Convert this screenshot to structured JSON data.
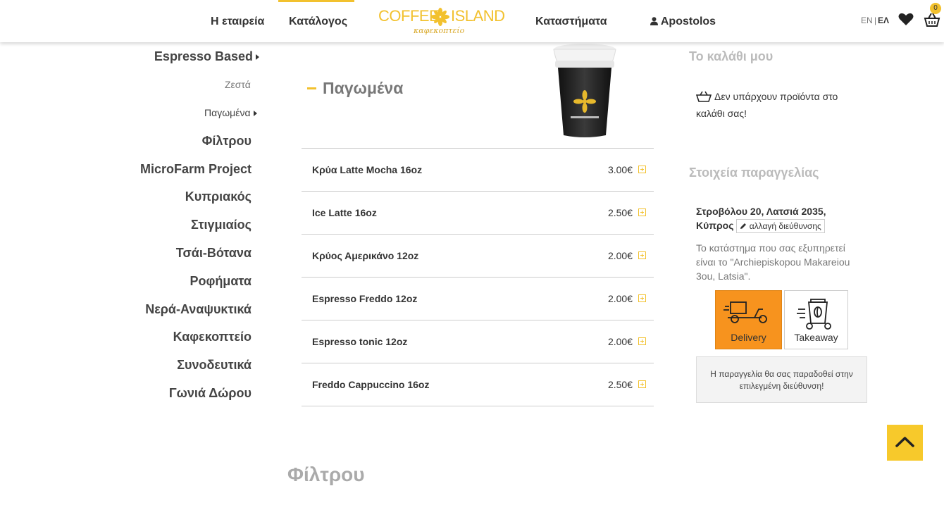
{
  "header": {
    "nav": {
      "company": "Η εταιρεία",
      "catalog": "Κατάλογος",
      "stores": "Καταστήματα",
      "user": "Apostolos"
    },
    "logo": {
      "brand_left": "COFFEE",
      "brand_right": "ISLAND",
      "tagline": "καφεκοπτείο"
    },
    "lang": {
      "en": "EN",
      "separator": "|",
      "el": "ΕΛ"
    },
    "cart_count": "0",
    "accent_color": "#f2c12e"
  },
  "sidebar": {
    "espresso_based": "Espresso Based",
    "sub_hot": "Ζεστά",
    "sub_iced": "Παγωμένα",
    "items": [
      "Φίλτρου",
      "MicroFarm Project",
      "Κυπριακός",
      "Στιγμιαίος",
      "Τσάι-Βότανα",
      "Ροφήματα",
      "Νερά-Αναψυκτικά",
      "Καφεκοπτείο",
      "Συνοδευτικά",
      "Γωνιά Δώρου"
    ]
  },
  "main": {
    "section_title": "Παγωμένα",
    "products": [
      {
        "name": "Κρύα Latte Mocha 16oz",
        "price": "3.00€"
      },
      {
        "name": "Ice Latte 16oz",
        "price": "2.50€"
      },
      {
        "name": "Κρύος Αμερικάνο 12oz",
        "price": "2.00€"
      },
      {
        "name": "Espresso Freddo 12oz",
        "price": "2.00€"
      },
      {
        "name": "Espresso tonic 12oz",
        "price": "2.00€"
      },
      {
        "name": "Freddo Cappuccino 16oz",
        "price": "2.50€"
      }
    ],
    "next_section": "Φίλτρου"
  },
  "cart": {
    "title": "Το καλάθι μου",
    "empty_text": "Δεν υπάρχουν προϊόντα στο καλάθι σας!"
  },
  "order": {
    "title": "Στοιχεία παραγγελίας",
    "address": "Στροβόλου 20, Λατσιά 2035, Κύπρος",
    "change_address": "αλλαγή διεύθυνσης",
    "store_note": "Το κατάστημα που σας εξυπηρετεί είναι το \"Archiepiskopou Makareiou 3ou, Latsia\".",
    "delivery_label": "Delivery",
    "takeaway_label": "Takeaway",
    "delivery_note": "Η παραγγελία θα σας παραδοθεί στην επιλεγμένη διεύθυνση!",
    "delivery_color": "#f7931e"
  }
}
